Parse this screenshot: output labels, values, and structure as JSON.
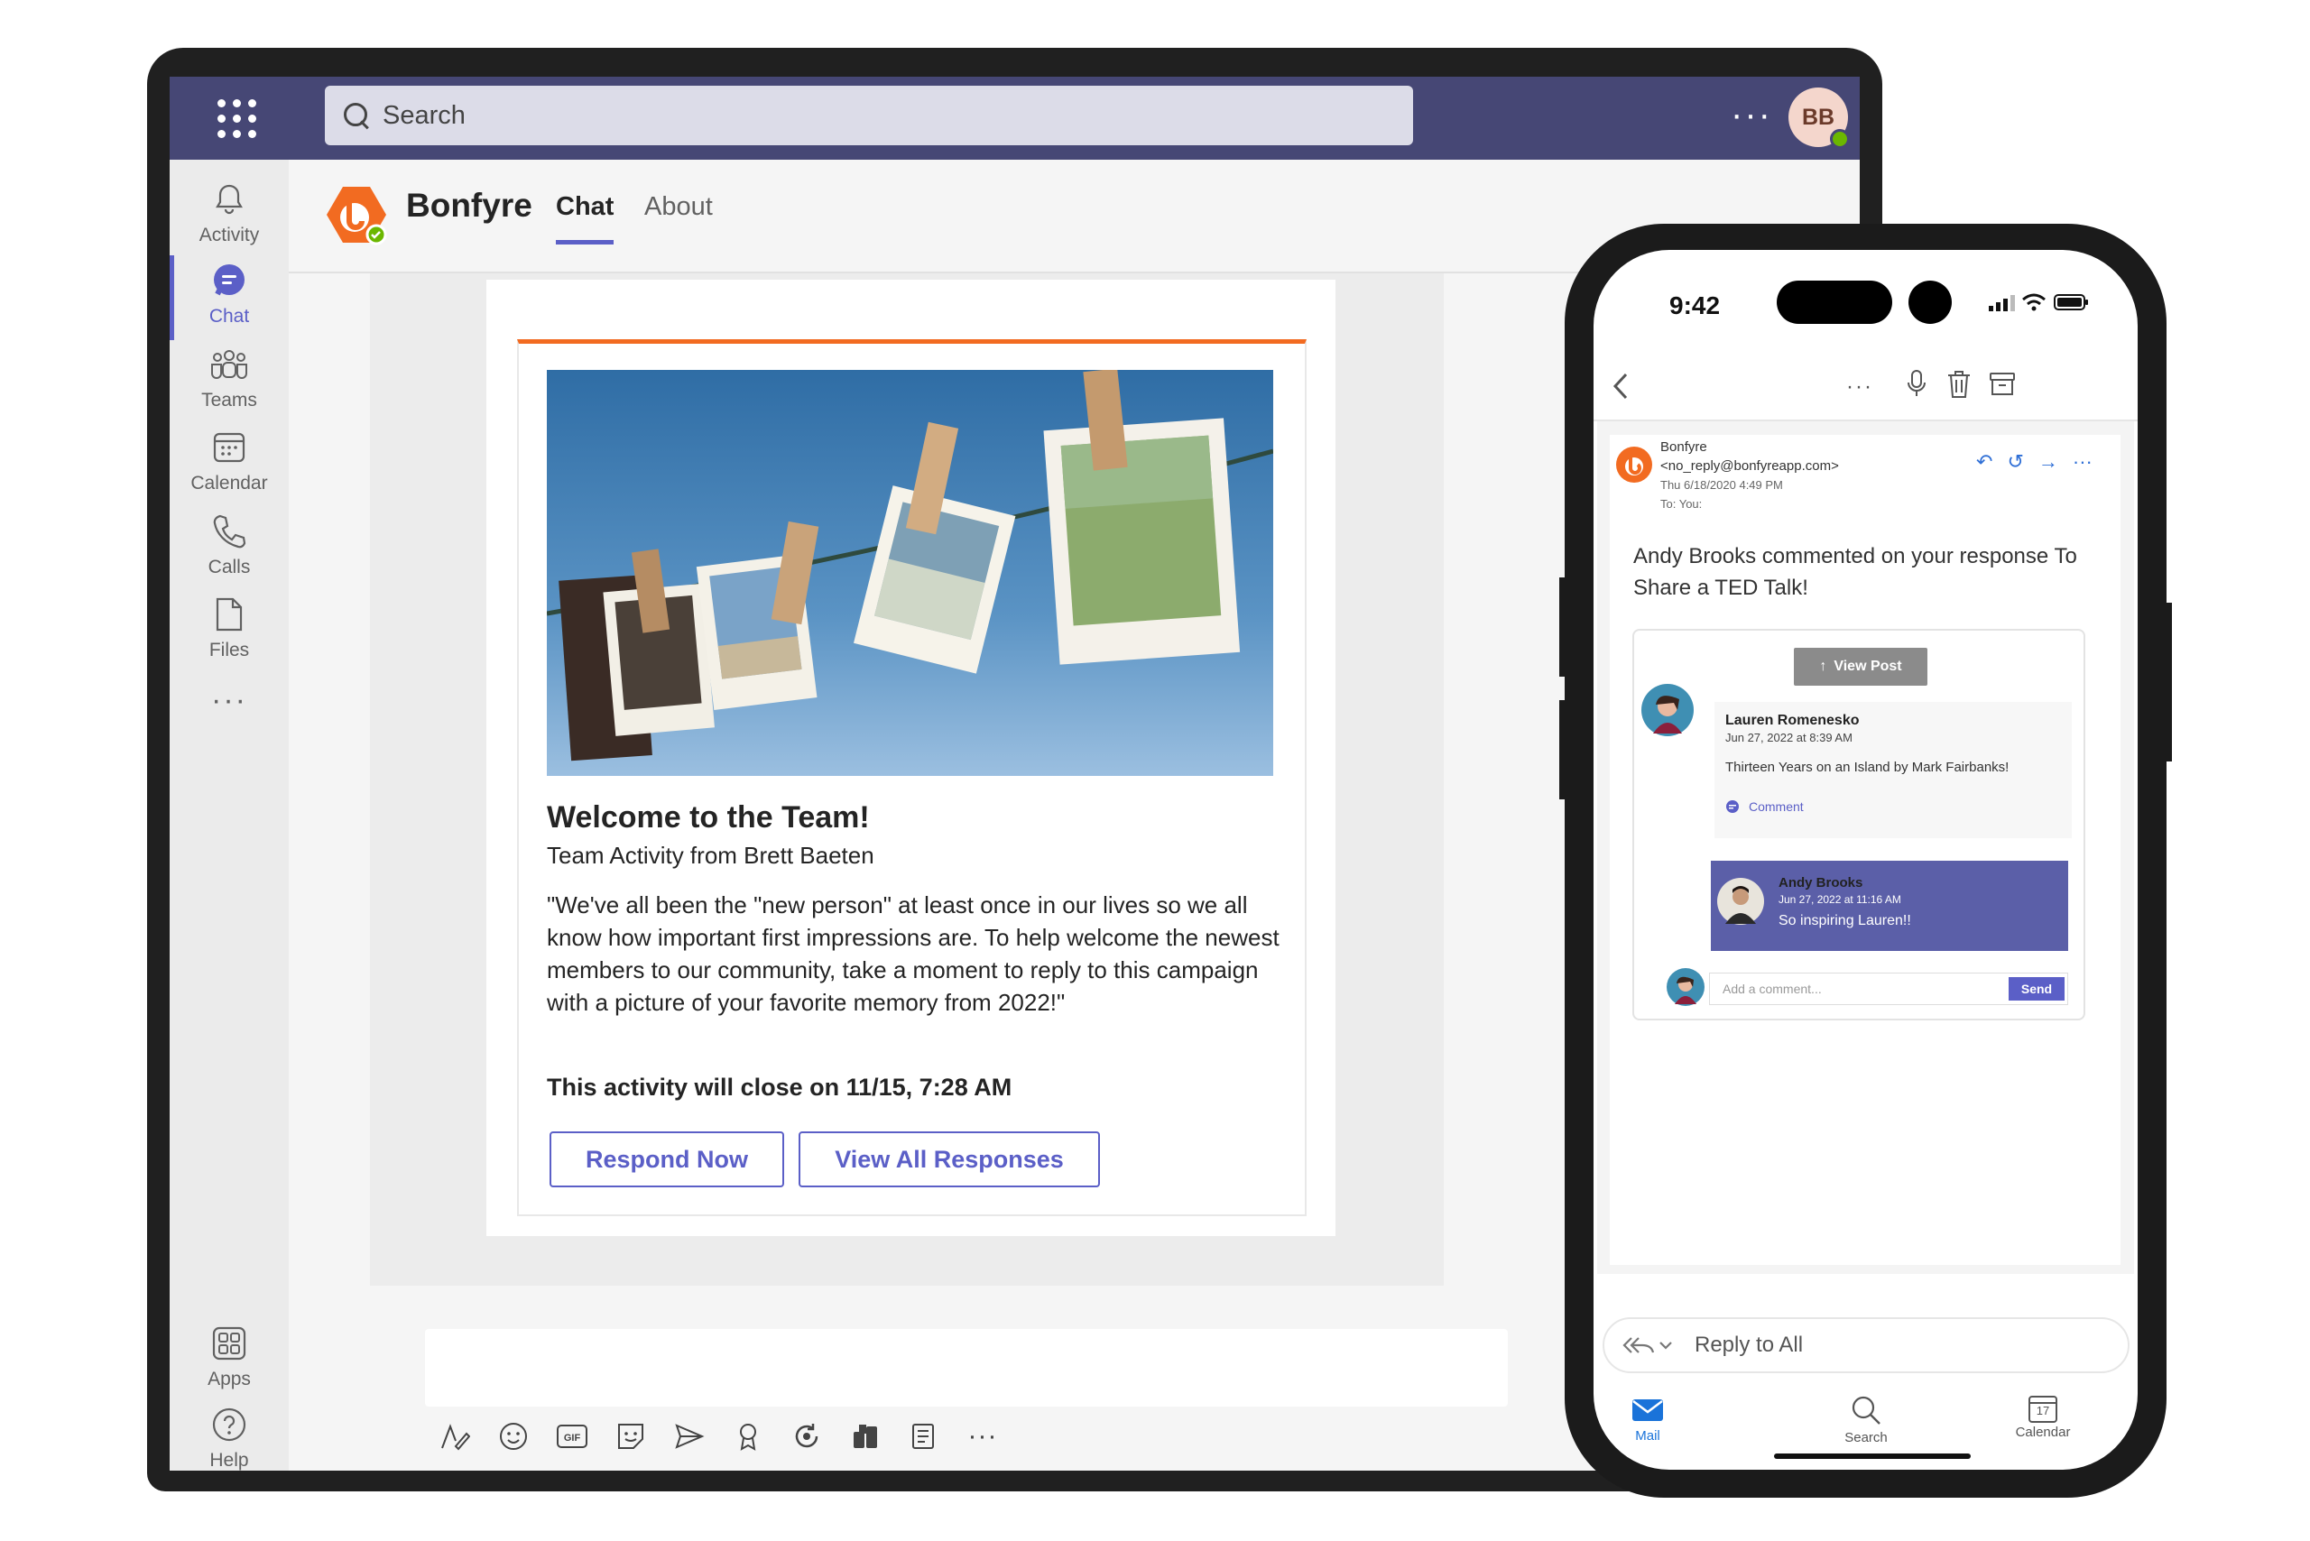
{
  "teams": {
    "search_placeholder": "Search",
    "more_label": "···",
    "user_initials": "BB",
    "rail": [
      {
        "label": "Activity",
        "icon": "bell-icon"
      },
      {
        "label": "Chat",
        "icon": "chat-icon",
        "active": true
      },
      {
        "label": "Teams",
        "icon": "teams-icon"
      },
      {
        "label": "Calendar",
        "icon": "calendar-icon"
      },
      {
        "label": "Calls",
        "icon": "phone-icon"
      },
      {
        "label": "Files",
        "icon": "file-icon"
      },
      {
        "label": "Apps",
        "icon": "apps-icon"
      },
      {
        "label": "Help",
        "icon": "help-icon"
      }
    ],
    "rail_more": "···",
    "app_name": "Bonfyre",
    "tabs": [
      "Chat",
      "About"
    ],
    "card": {
      "title": "Welcome to the Team!",
      "subtitle": "Team Activity from Brett Baeten",
      "body": "\"We've all been the \"new person\" at least once in our lives so we all know how important first impressions are. To help welcome the newest members to our community, take a moment to reply to this campaign with a picture of your favorite memory from 2022!\"",
      "closing": "This activity will close on 11/15, 7:28 AM",
      "respond_label": "Respond Now",
      "view_all_label": "View All Responses"
    },
    "compose_toolbar": [
      "format-icon",
      "emoji-icon",
      "gif-icon",
      "sticker-icon",
      "send-later-icon",
      "praise-icon",
      "loop-icon",
      "approvals-icon",
      "notes-icon",
      "more-icon"
    ],
    "compose_more": "···",
    "accent_color": "#5b5fc7",
    "brand_color": "#f26b21"
  },
  "phone": {
    "time": "9:42",
    "mail": {
      "sender_name": "Bonfyre",
      "sender_email": "<no_reply@bonfyreapp.com>",
      "date": "Thu 6/18/2020 4:49 PM",
      "to": "To:  You:",
      "headline": "Andy Brooks commented on your response To Share a TED Talk!",
      "view_post": "View Post",
      "comment": {
        "author": "Lauren Romenesko",
        "date": "Jun 27, 2022 at 8:39 AM",
        "text": "Thirteen Years on an Island by Mark Fairbanks!",
        "action": "Comment"
      },
      "reply": {
        "author": "Andy Brooks",
        "date": "Jun 27, 2022 at 11:16 AM",
        "text": "So inspiring Lauren!!"
      },
      "add_comment_placeholder": "Add a comment...",
      "send_label": "Send"
    },
    "reply_all": "Reply to All",
    "tabs": [
      {
        "label": "Mail",
        "active": true
      },
      {
        "label": "Search"
      },
      {
        "label": "Calendar"
      }
    ],
    "calendar_day": "17"
  }
}
